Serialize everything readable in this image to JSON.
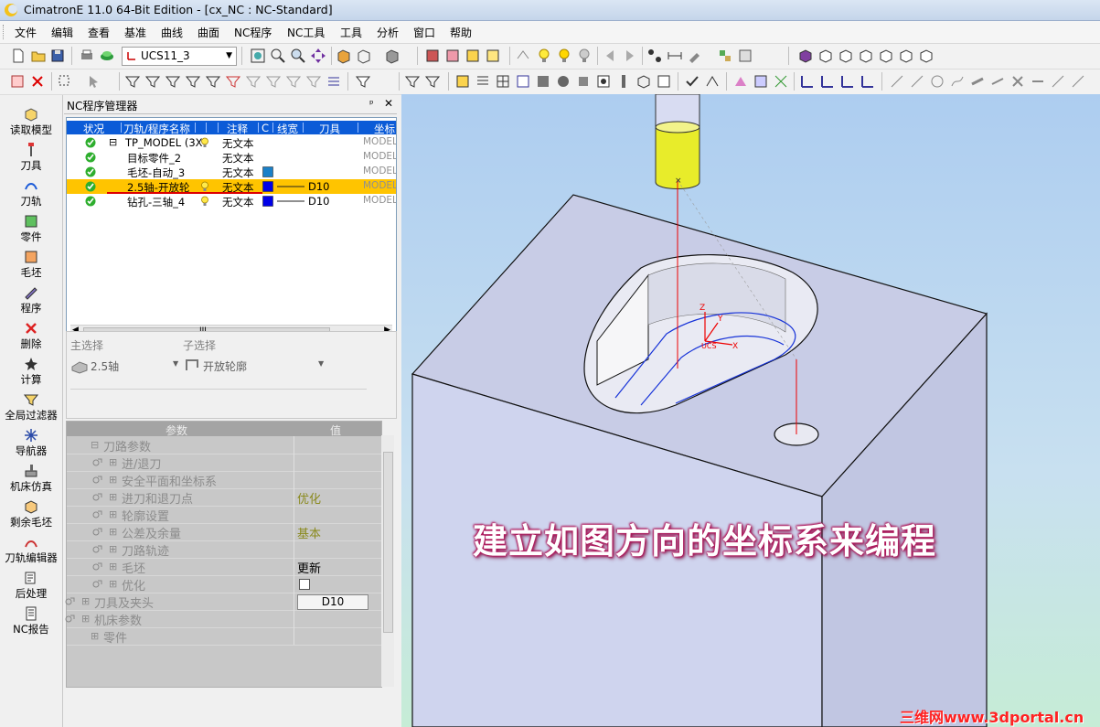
{
  "window": {
    "title": "CimatronE 11.0 64-Bit Edition - [cx_NC : NC-Standard]"
  },
  "menu": [
    "文件",
    "编辑",
    "查看",
    "基准",
    "曲线",
    "曲面",
    "NC程序",
    "NC工具",
    "工具",
    "分析",
    "窗口",
    "帮助"
  ],
  "ucs": {
    "value": "UCS11_3"
  },
  "left_toolbar": [
    "读取模型",
    "刀具",
    "刀轨",
    "零件",
    "毛坯",
    "程序",
    "删除",
    "计算",
    "全局过滤器",
    "导航器",
    "机床仿真",
    "剩余毛坯",
    "刀轨编辑器",
    "后处理",
    "NC报告"
  ],
  "nc_manager": {
    "title": "NC程序管理器",
    "pin": "ᵖ",
    "close": "✕",
    "columns": [
      "状况",
      "刀轨/程序名称",
      "",
      "注释",
      "C",
      "线宽",
      "刀具",
      "坐标"
    ],
    "rows": [
      {
        "name": "TP_MODEL (3X",
        "note": "无文本",
        "tool": "",
        "coord": "MODEL",
        "expand": "⊟",
        "bulb": true,
        "color": "",
        "selected": false
      },
      {
        "name": "目标零件_2",
        "note": "无文本",
        "tool": "",
        "coord": "MODEL",
        "expand": "",
        "bulb": false,
        "color": "",
        "selected": false
      },
      {
        "name": "毛坯-自动_3",
        "note": "无文本",
        "tool": "",
        "coord": "MODEL",
        "expand": "",
        "bulb": false,
        "color": "#1a80c8",
        "selected": false
      },
      {
        "name": "2.5轴-开放轮",
        "note": "无文本",
        "tool": "D10",
        "coord": "MODEL",
        "expand": "",
        "bulb": true,
        "color": "#0000e8",
        "selected": true
      },
      {
        "name": "钻孔-三轴_4",
        "note": "无文本",
        "tool": "D10",
        "coord": "MODEL",
        "expand": "",
        "bulb": true,
        "color": "#0000e8",
        "selected": false
      }
    ],
    "scroll_mid": "III"
  },
  "selection": {
    "main_label": "主选择",
    "sub_label": "子选择",
    "main_value": "2.5轴",
    "sub_value": "开放轮廓"
  },
  "params": {
    "col_param": "参数",
    "col_value": "值",
    "rows": [
      {
        "name": "刀路参数",
        "indent": 1,
        "value": "",
        "type": "text",
        "toggle": "⊟",
        "icon": false
      },
      {
        "name": "进/退刀",
        "indent": 2,
        "value": "",
        "type": "text",
        "toggle": "⊞",
        "icon": true
      },
      {
        "name": "安全平面和坐标系",
        "indent": 2,
        "value": "",
        "type": "text",
        "toggle": "⊞",
        "icon": true
      },
      {
        "name": "进刀和退刀点",
        "indent": 2,
        "value": "优化",
        "type": "olive",
        "toggle": "⊞",
        "icon": true
      },
      {
        "name": "轮廓设置",
        "indent": 2,
        "value": "",
        "type": "text",
        "toggle": "⊞",
        "icon": true
      },
      {
        "name": "公差及余量",
        "indent": 2,
        "value": "基本",
        "type": "olive",
        "toggle": "⊞",
        "icon": true
      },
      {
        "name": "刀路轨迹",
        "indent": 2,
        "value": "",
        "type": "text",
        "toggle": "⊞",
        "icon": true
      },
      {
        "name": "毛坯",
        "indent": 2,
        "value": "更新",
        "type": "black",
        "toggle": "⊞",
        "icon": true
      },
      {
        "name": "优化",
        "indent": 2,
        "value": "",
        "type": "checkbox",
        "toggle": "⊞",
        "icon": true
      },
      {
        "name": "刀具及夹头",
        "indent": 0,
        "value": "D10",
        "type": "button",
        "toggle": "⊞",
        "icon": true
      },
      {
        "name": "机床参数",
        "indent": 0,
        "value": "",
        "type": "text",
        "toggle": "⊞",
        "icon": true
      },
      {
        "name": "零件",
        "indent": 1,
        "value": "",
        "type": "text",
        "toggle": "⊞",
        "icon": false
      }
    ]
  },
  "viewport": {
    "caption": "建立如图方向的坐标系来编程",
    "watermark": "三维网www.3dportal.cn",
    "axis_labels": {
      "z": "Z",
      "y": "Y",
      "x": "X",
      "ucs": "UCS"
    }
  },
  "colors": {
    "header_blue": "#0b5bd7",
    "selection": "#ffc400",
    "tool_holder": "#e8ec2a",
    "toolpath": "#1733d8"
  }
}
